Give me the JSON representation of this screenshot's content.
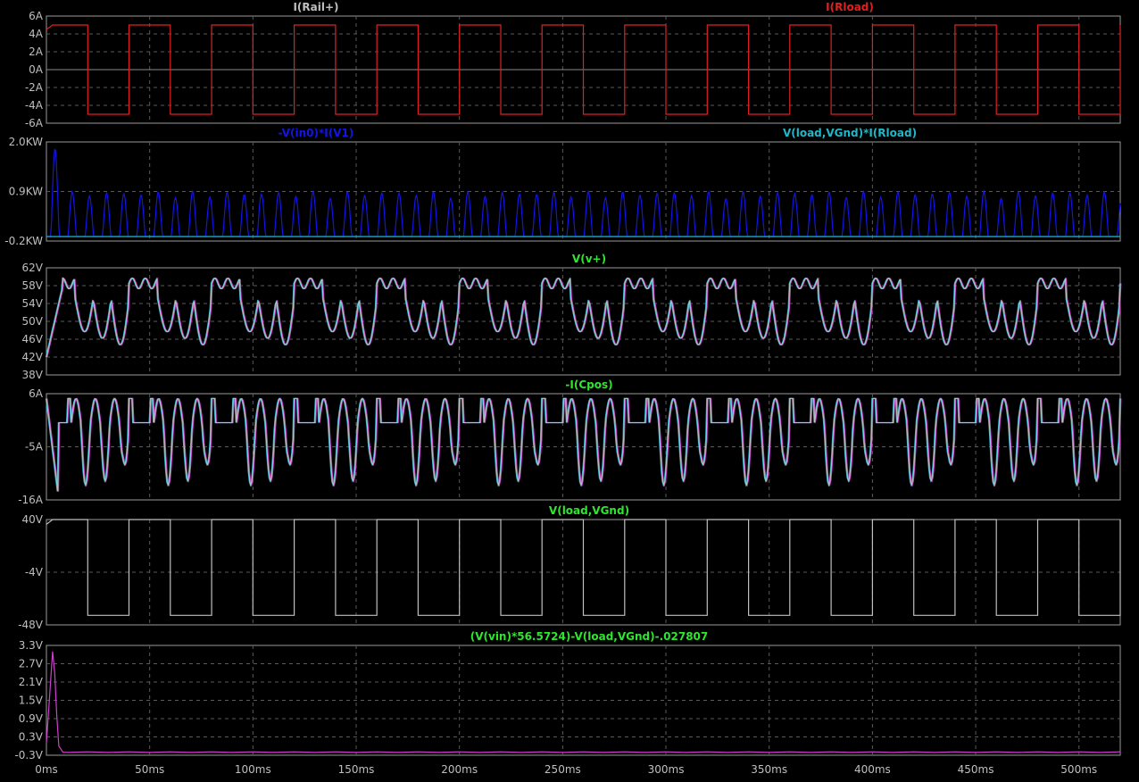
{
  "colors": {
    "background": "#000000",
    "frame": "#9a9a9a",
    "grid": "#5a5a5a",
    "zero_line": "#8c8c8c",
    "text": "#c0c0c0",
    "red": "#e02020",
    "blue": "#1414e6",
    "cyan": "#20b8c8",
    "green": "#2ee62e",
    "magenta": "#d040d0",
    "grey": "#bfbfbf"
  },
  "x_axis": {
    "ticks": [
      "0ms",
      "50ms",
      "100ms",
      "150ms",
      "200ms",
      "250ms",
      "300ms",
      "350ms",
      "400ms",
      "450ms",
      "500ms"
    ],
    "range_ms": [
      0,
      520
    ]
  },
  "chart_data": [
    {
      "type": "line",
      "title_labels": [
        {
          "text": "I(Rail+)",
          "color": "grey",
          "anchor": "grey"
        },
        {
          "text": "I(Rload)",
          "color": "red",
          "anchor": "red"
        }
      ],
      "ylim": [
        -6,
        6
      ],
      "y_ticks": [
        "6A",
        "4A",
        "2A",
        "0A",
        "-2A",
        "-4A",
        "-6A"
      ],
      "series": [
        {
          "name": "I(Rload)",
          "color": "red",
          "waveform": "square",
          "period_ms": 40,
          "amplitude": 5,
          "start_level": 5,
          "edge_ms": 20
        }
      ]
    },
    {
      "type": "line",
      "title_labels": [
        {
          "text": "-V(in0)*I(V1)",
          "color": "blue"
        },
        {
          "text": "V(load,VGnd)*I(Rload)",
          "color": "cyan"
        }
      ],
      "ylim": [
        -0.2,
        2.0
      ],
      "y_ticks": [
        "2.0KW",
        "0.9KW",
        "-0.2KW"
      ],
      "series": [
        {
          "name": "-V(in0)*I(V1)",
          "color": "blue",
          "waveform": "rectified_pulses",
          "pulse_period_ms": 8.33,
          "peak_kw": 0.9,
          "first_peak_kw": 1.85
        },
        {
          "name": "V(load,VGnd)*I(Rload)",
          "color": "cyan",
          "waveform": "flat",
          "value_kw": -0.1
        }
      ]
    },
    {
      "type": "line",
      "title_labels": [
        {
          "text": "V(v+)",
          "color": "green"
        }
      ],
      "ylim": [
        38,
        62
      ],
      "y_ticks": [
        "62V",
        "58V",
        "54V",
        "50V",
        "46V",
        "42V",
        "38V"
      ],
      "series": [
        {
          "name": "V(v+)",
          "color": "green",
          "waveform": "rail_ripple",
          "high_v": 59,
          "low_v": 44,
          "period_ms": 40
        }
      ]
    },
    {
      "type": "line",
      "title_labels": [
        {
          "text": "-I(Cpos)",
          "color": "green"
        }
      ],
      "ylim": [
        -16,
        6
      ],
      "y_ticks": [
        "6A",
        "-5A",
        "-16A"
      ],
      "series": [
        {
          "name": "-I(Cpos)",
          "color": "green",
          "waveform": "cap_current",
          "high_a": 5,
          "idle_a": 0,
          "low_a": -13,
          "period_ms": 40
        }
      ]
    },
    {
      "type": "line",
      "title_labels": [
        {
          "text": "V(load,VGnd)",
          "color": "green"
        }
      ],
      "ylim": [
        -48,
        40
      ],
      "y_ticks": [
        "40V",
        "-4V",
        "-48V"
      ],
      "series": [
        {
          "name": "V(load,VGnd)",
          "color": "grey",
          "waveform": "square",
          "period_ms": 40,
          "amplitude": 40,
          "start_level": 40,
          "edge_ms": 20
        }
      ]
    },
    {
      "type": "line",
      "title_labels": [
        {
          "text": "(V(vin)*56.5724)-V(load,VGnd)-.027807",
          "color": "green"
        }
      ],
      "ylim": [
        -0.3,
        3.3
      ],
      "y_ticks": [
        "3.3V",
        "2.7V",
        "2.1V",
        "1.5V",
        "0.9V",
        "0.3V",
        "-0.3V"
      ],
      "series": [
        {
          "name": "(V(vin)*56.5724)-V(load,VGnd)-.027807",
          "color": "magenta",
          "waveform": "startup_spike",
          "peak_v": 3.1,
          "peak_ms": 3,
          "settle_v": -0.2
        }
      ]
    }
  ]
}
